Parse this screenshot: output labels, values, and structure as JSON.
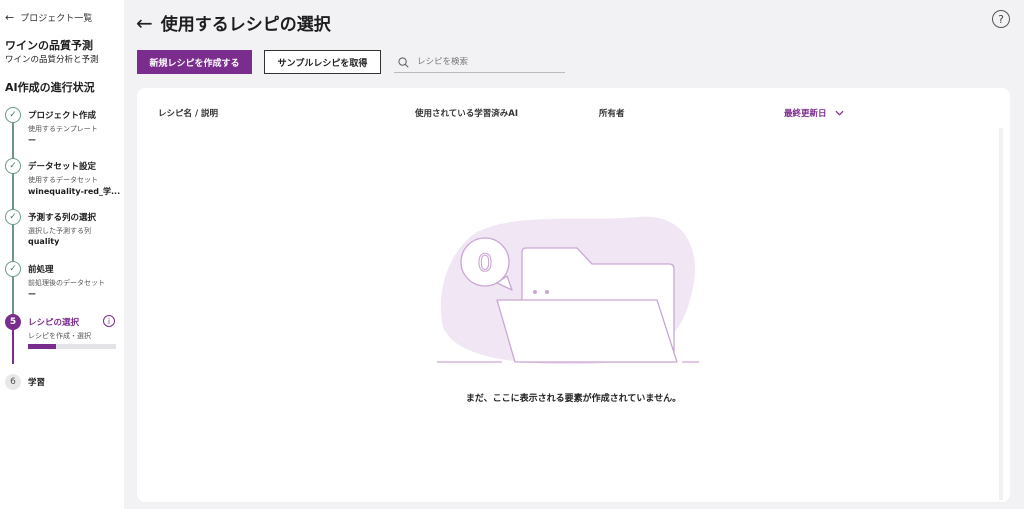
{
  "sidebar": {
    "back_label": "プロジェクト一覧",
    "project_title": "ワインの品質予測",
    "project_subtitle": "ワインの品質分析と予測",
    "progress_title": "AI作成の進行状況",
    "steps": [
      {
        "number": "✓",
        "title": "プロジェクト作成",
        "label": "使用するテンプレート",
        "value": "ー",
        "state": "done"
      },
      {
        "number": "✓",
        "title": "データセット設定",
        "label": "使用するデータセット",
        "value": "winequality-red_学...",
        "state": "done"
      },
      {
        "number": "✓",
        "title": "予測する列の選択",
        "label": "選択した予測する列",
        "value": "quality",
        "state": "done"
      },
      {
        "number": "✓",
        "title": "前処理",
        "label": "前処理後のデータセット",
        "value": "ー",
        "state": "done"
      },
      {
        "number": "5",
        "title": "レシピの選択",
        "label": "レシピを作成・選択",
        "progress": 0.32,
        "state": "active"
      },
      {
        "number": "6",
        "title": "学習",
        "state": "todo"
      }
    ]
  },
  "header": {
    "title": "使用するレシピの選択"
  },
  "toolbar": {
    "create_label": "新規レシピを作成する",
    "sample_label": "サンプルレシピを取得",
    "search_placeholder": "レシピを検索"
  },
  "table": {
    "columns": [
      "レシピ名 / 説明",
      "使用されている学習済みAI",
      "所有者",
      "最終更新日"
    ],
    "empty_message": "まだ、ここに表示される要素が作成されていません。",
    "empty_badge": "0"
  },
  "colors": {
    "accent": "#7b2d8e",
    "done": "#6a9a85",
    "illustration": "#f1e7f4"
  }
}
